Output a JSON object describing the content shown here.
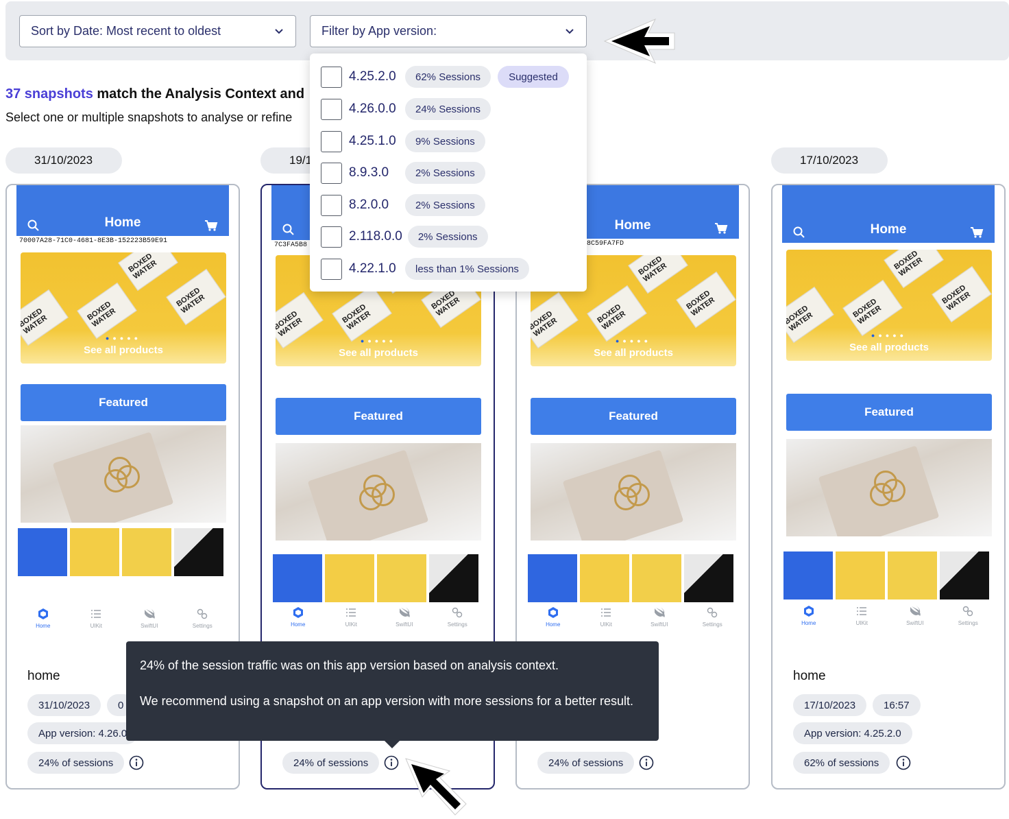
{
  "toolbar": {
    "sort_label": "Sort by Date: Most recent to oldest",
    "filter_label": "Filter by App version:"
  },
  "summary": {
    "count": "37 snapshots",
    "rest": " match the Analysis Context and",
    "subtitle": "Select one or multiple snapshots to analyse or refine"
  },
  "dropdown": {
    "options": [
      {
        "version": "4.25.2.0",
        "sessions": "62% Sessions",
        "badge": "Suggested"
      },
      {
        "version": "4.26.0.0",
        "sessions": "24% Sessions"
      },
      {
        "version": "4.25.1.0",
        "sessions": "9% Sessions"
      },
      {
        "version": "8.9.3.0",
        "sessions": "2% Sessions"
      },
      {
        "version": "8.2.0.0",
        "sessions": "2% Sessions"
      },
      {
        "version": "2.118.0.0",
        "sessions": "2% Sessions"
      },
      {
        "version": "4.22.1.0",
        "sessions": "less than 1% Sessions"
      }
    ]
  },
  "tooltip": {
    "line1": "24% of the session traffic was on this app version based on analysis context.",
    "line2": "We recommend using a snapshot on an app version with more sessions for a better result."
  },
  "app": {
    "header_title": "Home",
    "see_all": "See all products",
    "featured": "Featured",
    "carton_text": "BOXED WATER",
    "tabs": [
      "Home",
      "UIKit",
      "SwiftUI",
      "Settings"
    ],
    "accent": "#3c78e2"
  },
  "cards": [
    {
      "date": "31/10/2023",
      "snapshot_id": "70007A28-71C0-4681-8E3B-152223B59E91",
      "screen": "home",
      "chip_date": "31/10/2023",
      "chip_time": "0",
      "app_version": "App version: 4.26.0",
      "sessions": "24% of sessions"
    },
    {
      "date": "19/1",
      "snapshot_id": "7C3FA5B8",
      "screen": "",
      "sessions": "24% of sessions"
    },
    {
      "date": "",
      "snapshot_id": "-4870-934C-C358C59FA7FD",
      "screen": "",
      "sessions": "24% of sessions"
    },
    {
      "date": "17/10/2023",
      "snapshot_id": "",
      "screen": "home",
      "chip_date": "17/10/2023",
      "chip_time": "16:57",
      "app_version": "App version: 4.25.2.0",
      "sessions": "62% of sessions"
    }
  ],
  "colors": {
    "primary_text": "#2a2f6b",
    "count_accent": "#4a3fd6",
    "tooltip_bg": "#2d333e",
    "selected_border": "#24266b"
  }
}
